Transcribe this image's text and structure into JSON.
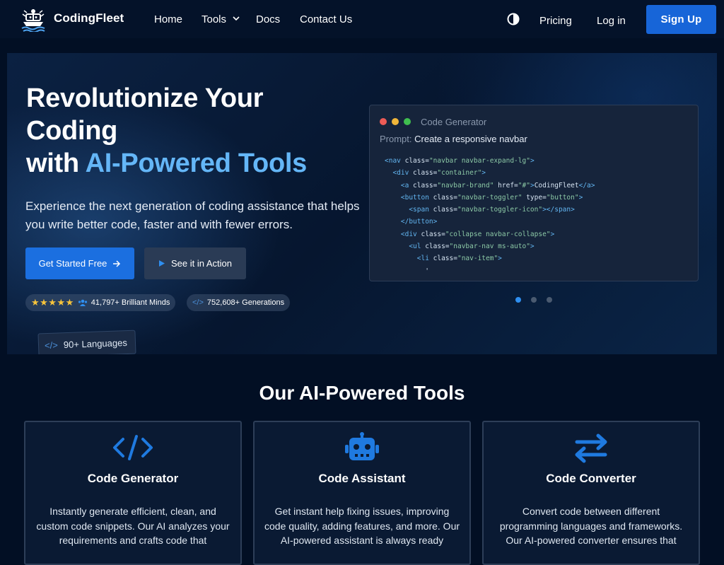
{
  "nav": {
    "brand": "CodingFleet",
    "links": [
      "Home",
      "Tools",
      "Docs",
      "Contact Us"
    ],
    "pricing": "Pricing",
    "login": "Log in",
    "signup": "Sign Up"
  },
  "hero": {
    "title_line1": "Revolutionize Your",
    "title_line2": "Coding",
    "title_line3_prefix": "with ",
    "title_line3_accent": "AI-Powered Tools",
    "subtitle": "Experience the next generation of coding assistance that helps you write better code, faster and with fewer errors.",
    "cta_primary": "Get Started Free",
    "cta_secondary": "See it in Action",
    "minds_count": "41,797+ Brilliant Minds",
    "generations_count": "752,608+ Generations",
    "languages": "90+ Languages"
  },
  "code_window": {
    "title": "Code Generator",
    "prompt_label": "Prompt:",
    "prompt_text": "Create a responsive navbar",
    "lines": [
      [
        {
          "t": "<nav ",
          "c": "tag"
        },
        {
          "t": "class=",
          "c": "attr"
        },
        {
          "t": "\"navbar navbar-expand-lg\"",
          "c": "str"
        },
        {
          "t": ">",
          "c": "tag"
        }
      ],
      [
        {
          "t": "  <div ",
          "c": "tag"
        },
        {
          "t": "class=",
          "c": "attr"
        },
        {
          "t": "\"container\"",
          "c": "str"
        },
        {
          "t": ">",
          "c": "tag"
        }
      ],
      [
        {
          "t": "    <a ",
          "c": "tag"
        },
        {
          "t": "class=",
          "c": "attr"
        },
        {
          "t": "\"navbar-brand\"",
          "c": "str"
        },
        {
          "t": " href=",
          "c": "attr"
        },
        {
          "t": "\"#\"",
          "c": "str"
        },
        {
          "t": ">",
          "c": "tag"
        },
        {
          "t": "CodingFleet",
          "c": "attr"
        },
        {
          "t": "</a>",
          "c": "tag"
        }
      ],
      [
        {
          "t": "    <button ",
          "c": "tag"
        },
        {
          "t": "class=",
          "c": "attr"
        },
        {
          "t": "\"navbar-toggler\"",
          "c": "str"
        },
        {
          "t": " type=",
          "c": "attr"
        },
        {
          "t": "\"button\"",
          "c": "str"
        },
        {
          "t": ">",
          "c": "tag"
        }
      ],
      [
        {
          "t": "      <span ",
          "c": "tag"
        },
        {
          "t": "class=",
          "c": "attr"
        },
        {
          "t": "\"navbar-toggler-icon\"",
          "c": "str"
        },
        {
          "t": "></span>",
          "c": "tag"
        }
      ],
      [
        {
          "t": "    </button>",
          "c": "tag"
        }
      ],
      [
        {
          "t": "    <div ",
          "c": "tag"
        },
        {
          "t": "class=",
          "c": "attr"
        },
        {
          "t": "\"collapse navbar-collapse\"",
          "c": "str"
        },
        {
          "t": ">",
          "c": "tag"
        }
      ],
      [
        {
          "t": "      <ul ",
          "c": "tag"
        },
        {
          "t": "class=",
          "c": "attr"
        },
        {
          "t": "\"navbar-nav ms-auto\"",
          "c": "str"
        },
        {
          "t": ">",
          "c": "tag"
        }
      ],
      [
        {
          "t": "        <li ",
          "c": "tag"
        },
        {
          "t": "class=",
          "c": "attr"
        },
        {
          "t": "\"nav-item\"",
          "c": "str"
        },
        {
          "t": ">",
          "c": "tag"
        }
      ],
      [
        {
          "t": "          '",
          "c": "attr"
        }
      ]
    ]
  },
  "carousel": {
    "count": 3,
    "active": 0
  },
  "tools": {
    "heading": "Our AI-Powered Tools",
    "cards": [
      {
        "icon": "code-icon",
        "title": "Code Generator",
        "desc": "Instantly generate efficient, clean, and custom code snippets. Our AI analyzes your requirements and crafts code that"
      },
      {
        "icon": "robot-icon",
        "title": "Code Assistant",
        "desc": "Get instant help fixing issues, improving code quality, adding features, and more. Our AI-powered assistant is always ready"
      },
      {
        "icon": "swap-arrows-icon",
        "title": "Code Converter",
        "desc": "Convert code between different programming languages and frameworks. Our AI-powered converter ensures that"
      }
    ]
  },
  "colors": {
    "accent": "#64b6f7",
    "primary": "#1b6fe0",
    "star": "#f7c43b"
  }
}
